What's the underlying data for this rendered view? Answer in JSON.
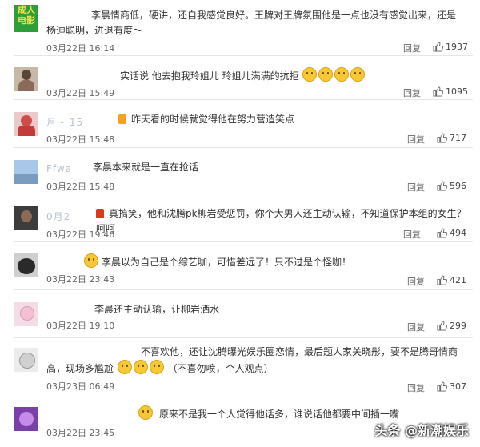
{
  "comments": [
    {
      "user": "",
      "text": "李晨情商低，硬讲，还自我感觉良好。王牌对王牌氛围他是一点也没有感觉出来，还是杨迪聪明，进退有度～",
      "date": "03月22日 16:14",
      "reply": "回复",
      "likes": "1937",
      "avatar": "logo",
      "avatar_text": [
        "成人",
        "电影"
      ]
    },
    {
      "user": "",
      "text": "实话说 他去抱我玲姐儿 玲姐儿满满的抗拒",
      "date": "03月22日 15:49",
      "reply": "回复",
      "likes": "1095",
      "avatar": "person",
      "emoji_count": 4
    },
    {
      "user": "月~      15",
      "text": "昨天看的时候就觉得他在努力营造笑点",
      "date": "03月22日 15:48",
      "reply": "回复",
      "likes": "717",
      "avatar": "red"
    },
    {
      "user": "Ffwa",
      "text": "李晨本来就是一直在抢话",
      "date": "03月22日 15:48",
      "reply": "回复",
      "likes": "596",
      "avatar": "sky"
    },
    {
      "user": "0月2",
      "text": "真搞笑，他和沈腾pk柳岩受惩罚，你个大男人还主动认输，不知道保护本组的女生？呵呵",
      "date": "03月22日 19:46",
      "reply": "回复",
      "likes": "494",
      "avatar": "dark"
    },
    {
      "user": "",
      "text": "李晨以为自己是个综艺咖，可惜差远了！只不过是个怪咖！",
      "date": "03月22日 23:43",
      "reply": "回复",
      "likes": "421",
      "avatar": "cat"
    },
    {
      "user": "",
      "text": "李晨还主动认输，让柳岩洒水",
      "date": "03月22日 19:10",
      "reply": "回复",
      "likes": "299",
      "avatar": "cartoon"
    },
    {
      "user": "",
      "text": "不喜欢他，还让沈腾曝光娱乐圈恋情，最后题人家关晓彤，要不是腾哥情商高，现场多尴尬",
      "text2": "（不喜勿喷，个人观点）",
      "date": "03月23日 06:49",
      "reply": "回复",
      "likes": "307",
      "avatar": "bunny"
    },
    {
      "user": "",
      "text": "原来不是我一个人觉得他话多，谁说话他都要中间插一嘴",
      "date": "03月22日 23:45",
      "reply": "",
      "likes": "",
      "avatar": "purple"
    }
  ],
  "watermark": "头条 @新潮娱乐",
  "colors": {
    "text": "#333333",
    "username": "#b7c3d1",
    "date": "#666666",
    "logo_bg": "#2e9e3a"
  }
}
